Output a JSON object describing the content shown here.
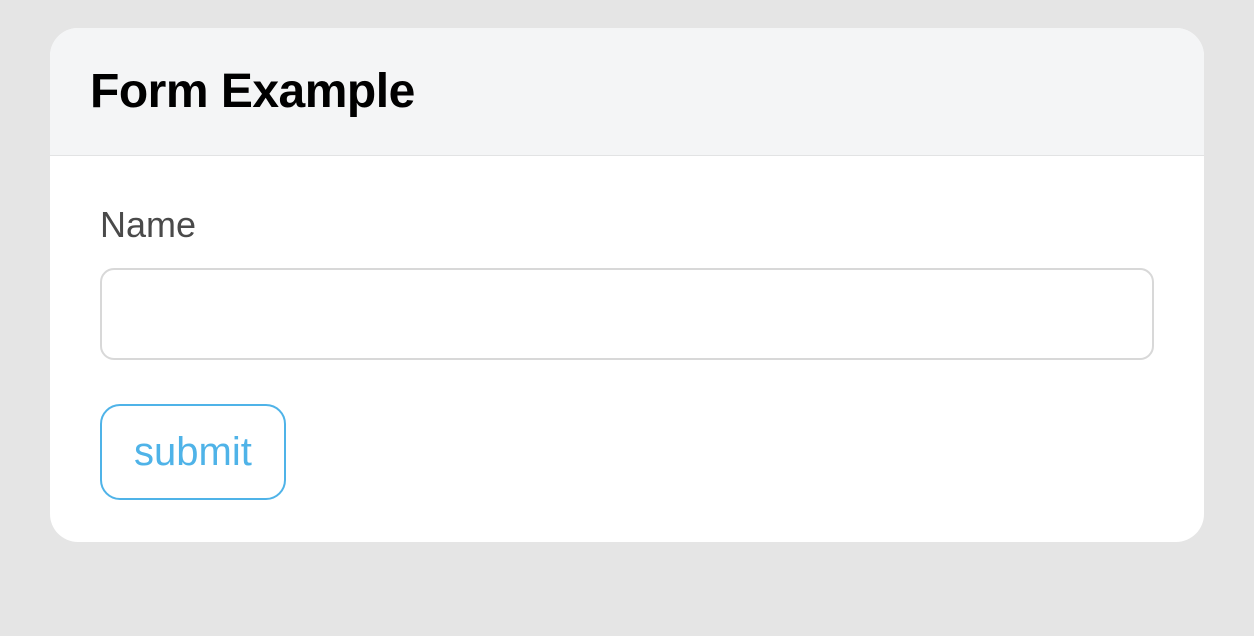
{
  "card": {
    "title": "Form Example"
  },
  "form": {
    "nameLabel": "Name",
    "nameValue": "",
    "submitLabel": "submit"
  }
}
